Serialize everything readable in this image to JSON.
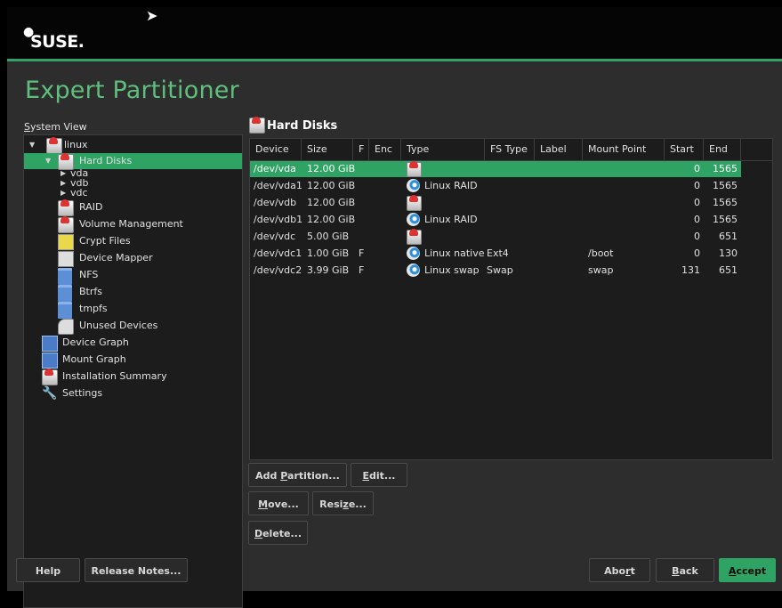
{
  "header": {
    "logo_text": "SUSE."
  },
  "page_title": "Expert Partitioner",
  "system_view_label": "System View",
  "tree": {
    "root": "linux",
    "hard_disks": "Hard Disks",
    "vda": "vda",
    "vdb": "vdb",
    "vdc": "vdc",
    "raid": "RAID",
    "volume_management": "Volume Management",
    "crypt_files": "Crypt Files",
    "device_mapper": "Device Mapper",
    "nfs": "NFS",
    "btrfs": "Btrfs",
    "tmpfs": "tmpfs",
    "unused_devices": "Unused Devices",
    "device_graph": "Device Graph",
    "mount_graph": "Mount Graph",
    "installation_summary": "Installation Summary",
    "settings": "Settings"
  },
  "content_title": "Hard Disks",
  "table": {
    "columns": [
      "Device",
      "Size",
      "F",
      "Enc",
      "Type",
      "FS Type",
      "Label",
      "Mount Point",
      "Start",
      "End"
    ],
    "rows": [
      {
        "device": "/dev/vda",
        "size": "12.00 GiB",
        "f": "",
        "enc": "",
        "type": "",
        "fs_type": "",
        "label": "",
        "mount": "",
        "start": "0",
        "end": "1565",
        "icon": "disk-icon"
      },
      {
        "device": "/dev/vda1",
        "size": "12.00 GiB",
        "f": "",
        "enc": "",
        "type": "Linux RAID",
        "fs_type": "",
        "label": "",
        "mount": "",
        "start": "0",
        "end": "1565",
        "icon": "partition-icon"
      },
      {
        "device": "/dev/vdb",
        "size": "12.00 GiB",
        "f": "",
        "enc": "",
        "type": "",
        "fs_type": "",
        "label": "",
        "mount": "",
        "start": "0",
        "end": "1565",
        "icon": "disk-icon"
      },
      {
        "device": "/dev/vdb1",
        "size": "12.00 GiB",
        "f": "",
        "enc": "",
        "type": "Linux RAID",
        "fs_type": "",
        "label": "",
        "mount": "",
        "start": "0",
        "end": "1565",
        "icon": "partition-icon"
      },
      {
        "device": "/dev/vdc",
        "size": "5.00 GiB",
        "f": "",
        "enc": "",
        "type": "",
        "fs_type": "",
        "label": "",
        "mount": "",
        "start": "0",
        "end": "651",
        "icon": "disk-icon"
      },
      {
        "device": "/dev/vdc1",
        "size": "1.00 GiB",
        "f": "F",
        "enc": "",
        "type": "Linux native",
        "fs_type": "Ext4",
        "label": "",
        "mount": "/boot",
        "start": "0",
        "end": "130",
        "icon": "partition-icon"
      },
      {
        "device": "/dev/vdc2",
        "size": "3.99 GiB",
        "f": "F",
        "enc": "",
        "type": "Linux swap",
        "fs_type": "Swap",
        "label": "",
        "mount": "swap",
        "start": "131",
        "end": "651",
        "icon": "partition-icon"
      }
    ]
  },
  "buttons": {
    "add_partition_pre": "Add ",
    "add_partition_key": "P",
    "add_partition_post": "artition...",
    "edit_key": "E",
    "edit_post": "dit...",
    "move_key": "M",
    "move_post": "ove...",
    "resize_pre": "Resi",
    "resize_key": "z",
    "resize_post": "e...",
    "delete_key": "D",
    "delete_post": "elete...",
    "help": "Help",
    "release_notes": "Release Notes...",
    "abort_pre": "Abo",
    "abort_key": "r",
    "abort_post": "t",
    "back_key": "B",
    "back_post": "ack",
    "accept_key": "A",
    "accept_post": "ccept"
  },
  "colors": {
    "accent": "#2fa363",
    "title": "#5fbf7c"
  }
}
